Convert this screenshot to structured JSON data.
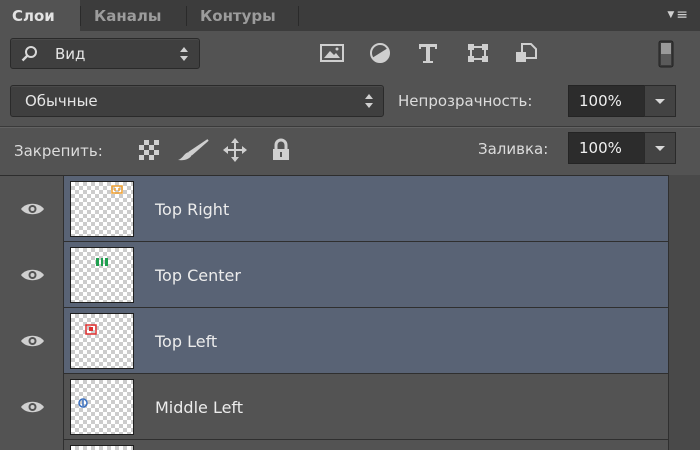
{
  "tabs": [
    {
      "label": "Слои",
      "active": true
    },
    {
      "label": "Каналы",
      "active": false
    },
    {
      "label": "Контуры",
      "active": false
    }
  ],
  "filter": {
    "kind_label": "Вид",
    "icons": [
      "image-filter-icon",
      "adjustment-filter-icon",
      "type-filter-icon",
      "shape-filter-icon",
      "smart-object-filter-icon",
      "filter-toggle-icon"
    ]
  },
  "blend": {
    "mode": "Обычные",
    "opacity_label": "Непрозрачность:",
    "opacity_value": "100%"
  },
  "lock": {
    "label": "Закрепить:",
    "fill_label": "Заливка:",
    "fill_value": "100%",
    "icons": [
      "lock-transparent-pixels-icon",
      "lock-image-pixels-icon",
      "lock-position-icon",
      "lock-all-icon"
    ]
  },
  "layers": [
    {
      "name": "Top Right",
      "selected": true,
      "marker_color": "#f0a030"
    },
    {
      "name": "Top Center",
      "selected": true,
      "marker_color": "#20a050"
    },
    {
      "name": "Top Left",
      "selected": true,
      "marker_color": "#e03030"
    },
    {
      "name": "Middle Left",
      "selected": false,
      "marker_color": "#3a70c0"
    }
  ],
  "colors": {
    "panel": "#535353",
    "selected_row": "#596375",
    "tabbar": "#3c3c3c"
  }
}
